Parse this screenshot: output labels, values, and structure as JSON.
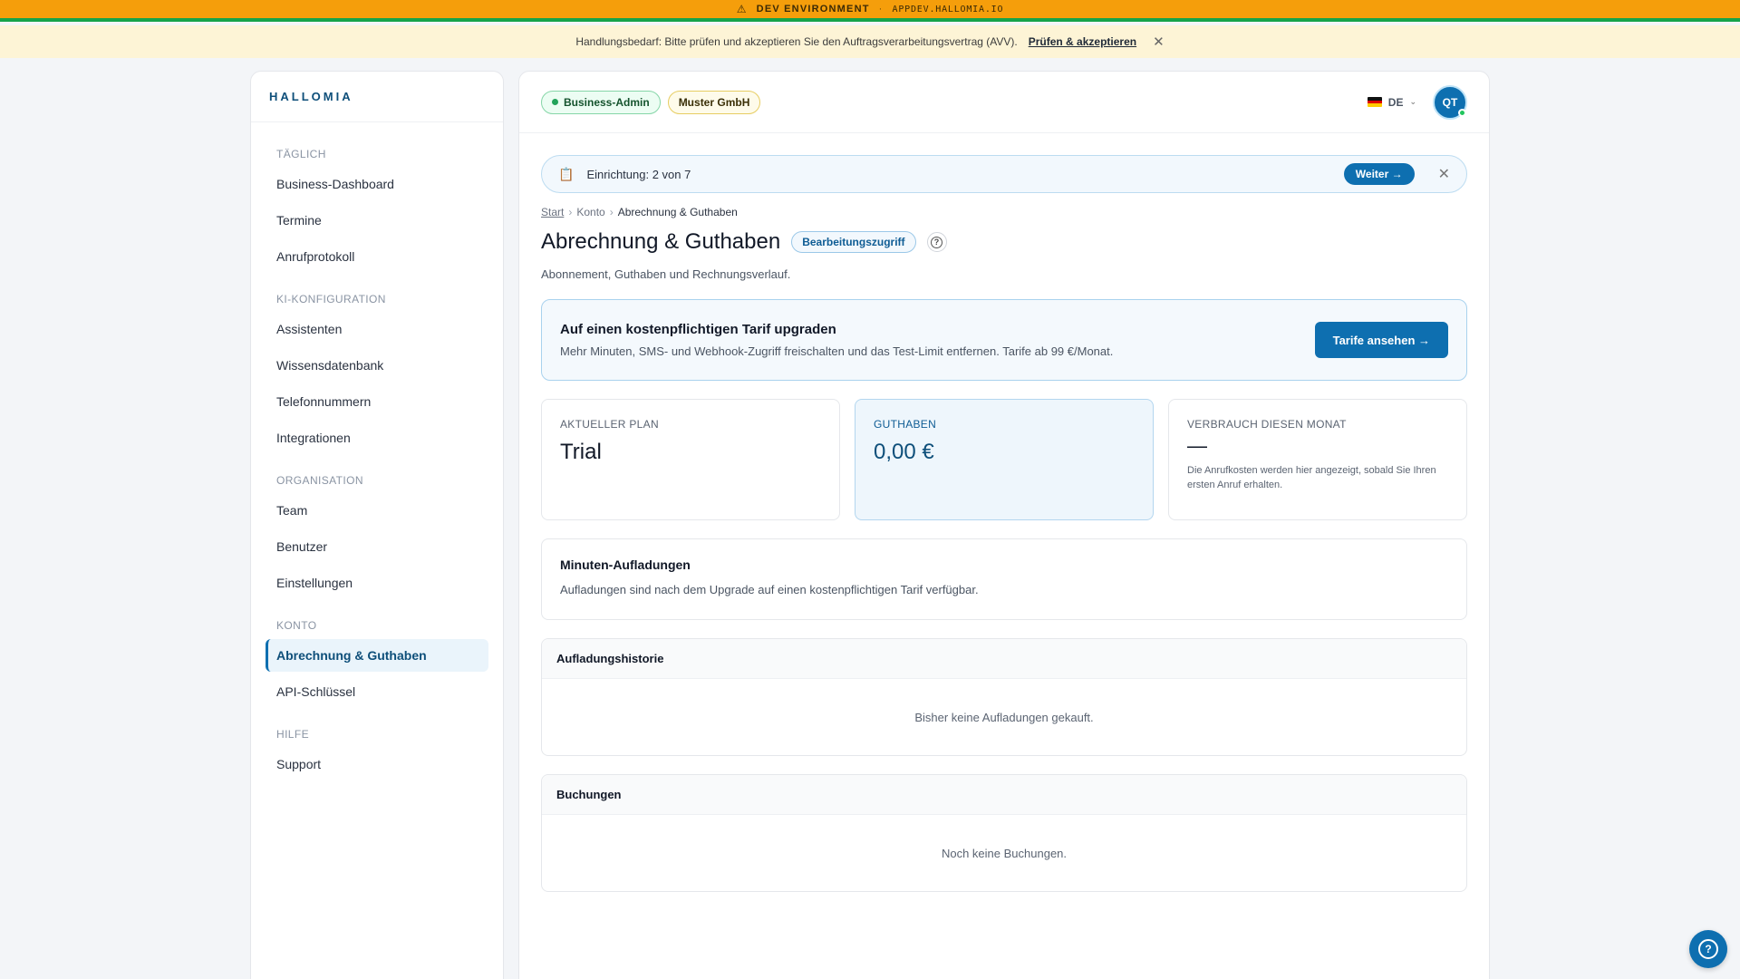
{
  "devbar": {
    "icon": "warning-icon",
    "label": "DEV ENVIRONMENT",
    "separator": "·",
    "url": "APPDEV.HALLOMIA.IO"
  },
  "notice": {
    "text": "Handlungsbedarf: Bitte prüfen und akzeptieren Sie den Auftragsverarbeitungsvertrag (AVV).",
    "link": "Prüfen & akzeptieren",
    "close_icon": "close-icon"
  },
  "sidebar": {
    "brand": "HALLOMIA",
    "sections": [
      {
        "label": "TÄGLICH",
        "items": [
          "Business-Dashboard",
          "Termine",
          "Anrufprotokoll"
        ]
      },
      {
        "label": "KI-KONFIGURATION",
        "items": [
          "Assistenten",
          "Wissensdatenbank",
          "Telefonnummern",
          "Integrationen"
        ]
      },
      {
        "label": "ORGANISATION",
        "items": [
          "Team",
          "Benutzer",
          "Einstellungen"
        ]
      },
      {
        "label": "KONTO",
        "items": [
          "Abrechnung & Guthaben",
          "API-Schlüssel"
        ]
      },
      {
        "label": "HILFE",
        "items": [
          "Support"
        ]
      }
    ],
    "active_item": "Abrechnung & Guthaben"
  },
  "topbar": {
    "role_chip": "Business-Admin",
    "org_chip": "Muster GmbH",
    "language": "DE",
    "avatar_initials": "QT"
  },
  "setup": {
    "icon": "clipboard-icon",
    "text": "Einrichtung: 2 von 7",
    "button": "Weiter →"
  },
  "breadcrumb": [
    "Start",
    "Konto",
    "Abrechnung & Guthaben"
  ],
  "page": {
    "title": "Abrechnung & Guthaben",
    "badge": "Bearbeitungszugriff",
    "subtitle": "Abonnement, Guthaben und Rechnungsverlauf."
  },
  "upgrade": {
    "title": "Auf einen kostenpflichtigen Tarif upgraden",
    "description": "Mehr Minuten, SMS- und Webhook-Zugriff freischalten und das Test-Limit entfernen. Tarife ab 99 €/Monat.",
    "button": "Tarife ansehen →"
  },
  "cards": {
    "plan": {
      "label": "AKTUELLER PLAN",
      "value": "Trial"
    },
    "credit": {
      "label": "GUTHABEN",
      "value": "0,00 €"
    },
    "usage": {
      "label": "VERBRAUCH DIESEN MONAT",
      "value": "—",
      "note": "Die Anrufkosten werden hier angezeigt, sobald Sie Ihren ersten Anruf erhalten."
    }
  },
  "topups": {
    "title": "Minuten-Aufladungen",
    "description": "Aufladungen sind nach dem Upgrade auf einen kostenpflichtigen Tarif verfügbar."
  },
  "history": {
    "title": "Aufladungshistorie",
    "empty": "Bisher keine Aufladungen gekauft."
  },
  "bookings": {
    "title": "Buchungen",
    "empty": "Noch keine Buchungen."
  },
  "colors": {
    "accent": "#0e6fb0",
    "devbar": "#f59e0b",
    "devbar_border": "#16a34a",
    "notice_bg": "#fdf4d6"
  }
}
